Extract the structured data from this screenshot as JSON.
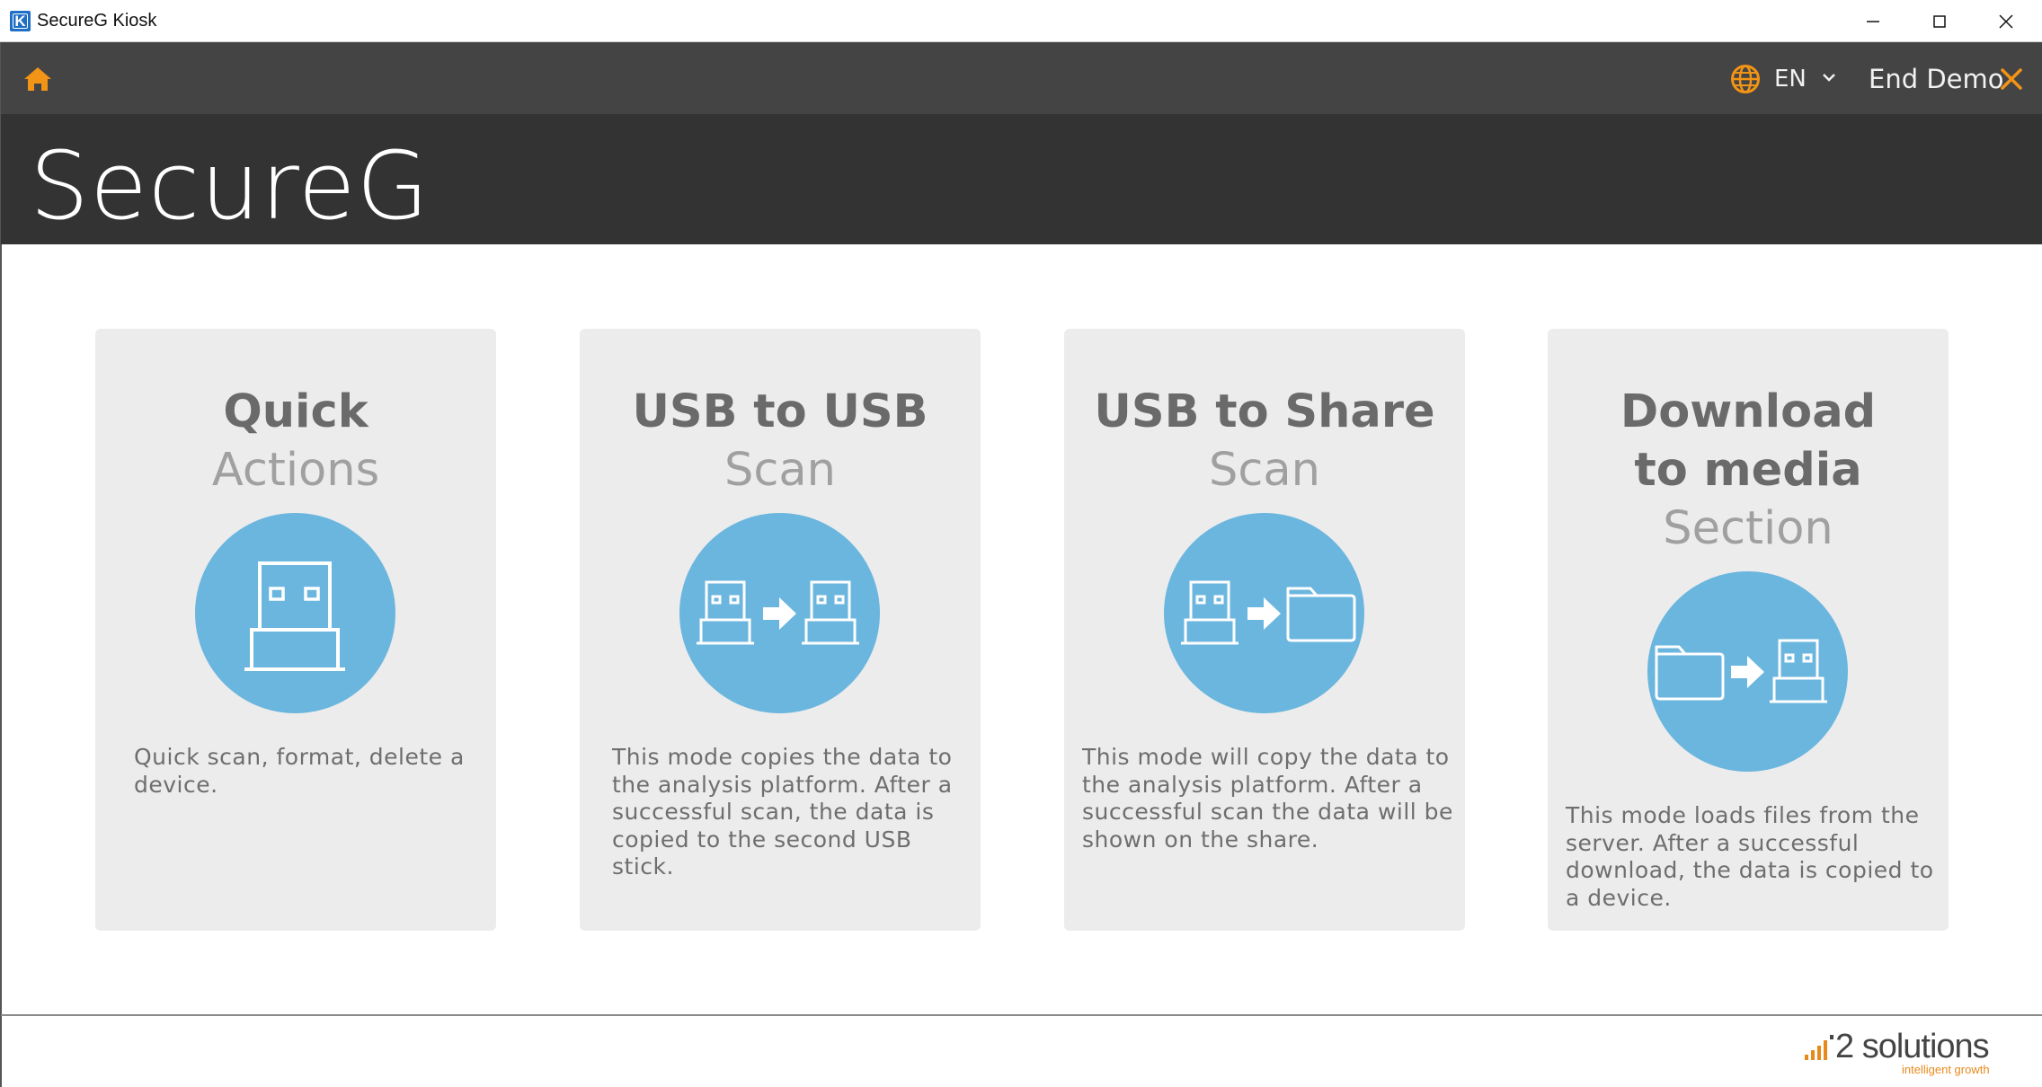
{
  "window": {
    "title": "SecureG Kiosk",
    "app_icon_letter": "K",
    "controls": [
      "minimize-icon",
      "maximize-icon",
      "close-icon"
    ]
  },
  "navbar": {
    "home_icon": "home-icon",
    "language": {
      "icon": "globe-icon",
      "value": "EN",
      "dropdown_icon": "chevron-down-icon"
    },
    "end_demo": {
      "label": "End Demo",
      "icon": "close-x-icon"
    }
  },
  "hero": {
    "title": "SecureG"
  },
  "cards": [
    {
      "title": "Quick",
      "subtitle": "Actions",
      "icon": "usb-stick-icon",
      "description": "Quick scan, format, delete a device."
    },
    {
      "title": "USB to USB",
      "subtitle": "Scan",
      "icon": "usb-to-usb-icon",
      "description": "This mode copies the data to the analysis platform. After a successful scan, the data is copied to the second USB stick."
    },
    {
      "title": "USB to Share",
      "subtitle": "Scan",
      "icon": "usb-to-folder-icon",
      "description": "This mode will copy the data to the analysis platform. After a successful scan the data will be shown on the share."
    },
    {
      "title": "Download to media",
      "subtitle": "Section",
      "icon": "folder-to-usb-icon",
      "description": "This mode loads files  from the server. After a successful download, the data is copied to a device."
    }
  ],
  "footer": {
    "logo_name": "2 solutions",
    "logo_tagline": "intelligent growth"
  },
  "colors": {
    "accent": "#f29415",
    "circle": "#6bb6de",
    "navbar": "#444444",
    "hero": "#333333",
    "card_bg": "#ececec"
  }
}
